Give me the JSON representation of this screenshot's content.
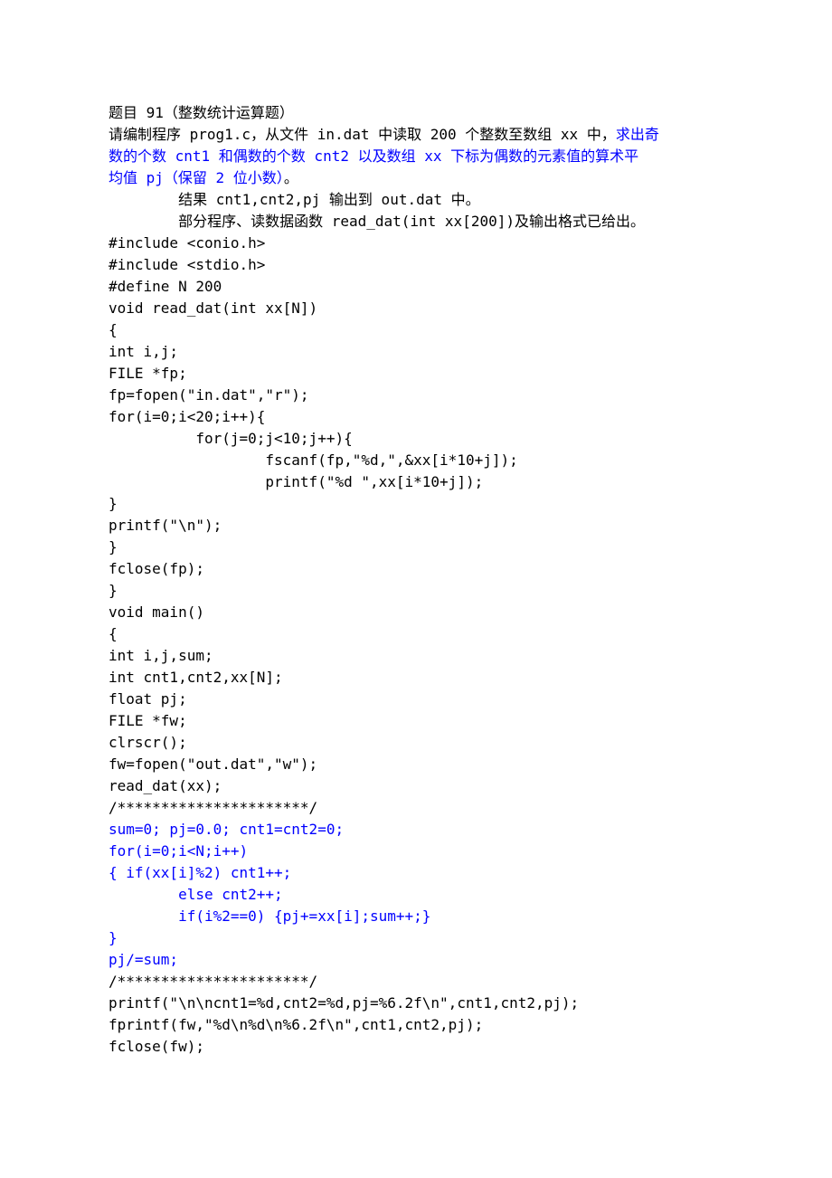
{
  "lines": [
    {
      "id": "l01",
      "segments": [
        {
          "t": "题目 91（整数统计运算题）",
          "c": "black"
        }
      ]
    },
    {
      "id": "l02",
      "segments": [
        {
          "t": "请编制程序 prog1.c，从文件 in.dat 中读取 200 个整数至数组 xx 中，",
          "c": "black"
        },
        {
          "t": "求出奇",
          "c": "blue"
        }
      ]
    },
    {
      "id": "l03",
      "segments": [
        {
          "t": "数的个数 cnt1 和偶数的个数 cnt2 以及数组 xx 下标为偶数的元素值的算术平",
          "c": "blue"
        }
      ]
    },
    {
      "id": "l04",
      "segments": [
        {
          "t": "均值 pj（保留 2 位小数）",
          "c": "blue"
        },
        {
          "t": "。",
          "c": "black"
        }
      ]
    },
    {
      "id": "l05",
      "segments": [
        {
          "t": "        结果 cnt1,cnt2,pj 输出到 out.dat 中。",
          "c": "black"
        }
      ]
    },
    {
      "id": "l06",
      "segments": [
        {
          "t": "        部分程序、读数据函数 read_dat(int xx[200])及输出格式已给出。",
          "c": "black"
        }
      ]
    },
    {
      "id": "l07",
      "segments": [
        {
          "t": "#include <conio.h>",
          "c": "black"
        }
      ]
    },
    {
      "id": "l08",
      "segments": [
        {
          "t": "#include <stdio.h>",
          "c": "black"
        }
      ]
    },
    {
      "id": "l09",
      "segments": [
        {
          "t": "#define N 200",
          "c": "black"
        }
      ]
    },
    {
      "id": "l10",
      "segments": [
        {
          "t": "void read_dat(int xx[N])",
          "c": "black"
        }
      ]
    },
    {
      "id": "l11",
      "segments": [
        {
          "t": "{",
          "c": "black"
        }
      ]
    },
    {
      "id": "l12",
      "segments": [
        {
          "t": "int i,j;",
          "c": "black"
        }
      ]
    },
    {
      "id": "l13",
      "segments": [
        {
          "t": "FILE *fp;",
          "c": "black"
        }
      ]
    },
    {
      "id": "l14",
      "segments": [
        {
          "t": "fp=fopen(\"in.dat\",\"r\");",
          "c": "black"
        }
      ]
    },
    {
      "id": "l15",
      "segments": [
        {
          "t": "for(i=0;i<20;i++){",
          "c": "black"
        }
      ]
    },
    {
      "id": "l16",
      "segments": [
        {
          "t": "          for(j=0;j<10;j++){",
          "c": "black"
        }
      ]
    },
    {
      "id": "l17",
      "segments": [
        {
          "t": "                  fscanf(fp,\"%d,\",&xx[i*10+j]);",
          "c": "black"
        }
      ]
    },
    {
      "id": "l18",
      "segments": [
        {
          "t": "                  printf(\"%d \",xx[i*10+j]);",
          "c": "black"
        }
      ]
    },
    {
      "id": "l19",
      "segments": [
        {
          "t": "}",
          "c": "black"
        }
      ]
    },
    {
      "id": "l20",
      "segments": [
        {
          "t": "printf(\"\\n\");",
          "c": "black"
        }
      ]
    },
    {
      "id": "l21",
      "segments": [
        {
          "t": "}",
          "c": "black"
        }
      ]
    },
    {
      "id": "l22",
      "segments": [
        {
          "t": "fclose(fp);",
          "c": "black"
        }
      ]
    },
    {
      "id": "l23",
      "segments": [
        {
          "t": "}",
          "c": "black"
        }
      ]
    },
    {
      "id": "l24",
      "segments": [
        {
          "t": "void main()",
          "c": "black"
        }
      ]
    },
    {
      "id": "l25",
      "segments": [
        {
          "t": "{",
          "c": "black"
        }
      ]
    },
    {
      "id": "l26",
      "segments": [
        {
          "t": "int i,j,sum;",
          "c": "black"
        }
      ]
    },
    {
      "id": "l27",
      "segments": [
        {
          "t": "int cnt1,cnt2,xx[N];",
          "c": "black"
        }
      ]
    },
    {
      "id": "l28",
      "segments": [
        {
          "t": "float pj;",
          "c": "black"
        }
      ]
    },
    {
      "id": "l29",
      "segments": [
        {
          "t": "FILE *fw;",
          "c": "black"
        }
      ]
    },
    {
      "id": "l30",
      "segments": [
        {
          "t": "clrscr();",
          "c": "black"
        }
      ]
    },
    {
      "id": "l31",
      "segments": [
        {
          "t": "fw=fopen(\"out.dat\",\"w\");",
          "c": "black"
        }
      ]
    },
    {
      "id": "l32",
      "segments": [
        {
          "t": "read_dat(xx);",
          "c": "black"
        }
      ]
    },
    {
      "id": "l33",
      "segments": [
        {
          "t": "/**********************/",
          "c": "black"
        }
      ]
    },
    {
      "id": "l34",
      "segments": [
        {
          "t": "sum=0; pj=0.0; cnt1=cnt2=0;",
          "c": "blue"
        }
      ]
    },
    {
      "id": "l35",
      "segments": [
        {
          "t": "for(i=0;i<N;i++)",
          "c": "blue"
        }
      ]
    },
    {
      "id": "l36",
      "segments": [
        {
          "t": "{ if(xx[i]%2) cnt1++;",
          "c": "blue"
        }
      ]
    },
    {
      "id": "l37",
      "segments": [
        {
          "t": "        else cnt2++;",
          "c": "blue"
        }
      ]
    },
    {
      "id": "l38",
      "segments": [
        {
          "t": "        if(i%2==0) {pj+=xx[i];sum++;}",
          "c": "blue"
        }
      ]
    },
    {
      "id": "l39",
      "segments": [
        {
          "t": "}",
          "c": "blue"
        }
      ]
    },
    {
      "id": "l40",
      "segments": [
        {
          "t": "pj/=sum;",
          "c": "blue"
        }
      ]
    },
    {
      "id": "l41",
      "segments": [
        {
          "t": "/**********************/",
          "c": "black"
        }
      ]
    },
    {
      "id": "l42",
      "segments": [
        {
          "t": "printf(\"\\n\\ncnt1=%d,cnt2=%d,pj=%6.2f\\n\",cnt1,cnt2,pj);",
          "c": "black"
        }
      ]
    },
    {
      "id": "l43",
      "segments": [
        {
          "t": "fprintf(fw,\"%d\\n%d\\n%6.2f\\n\",cnt1,cnt2,pj);",
          "c": "black"
        }
      ]
    },
    {
      "id": "l44",
      "segments": [
        {
          "t": "fclose(fw);",
          "c": "black"
        }
      ]
    }
  ]
}
